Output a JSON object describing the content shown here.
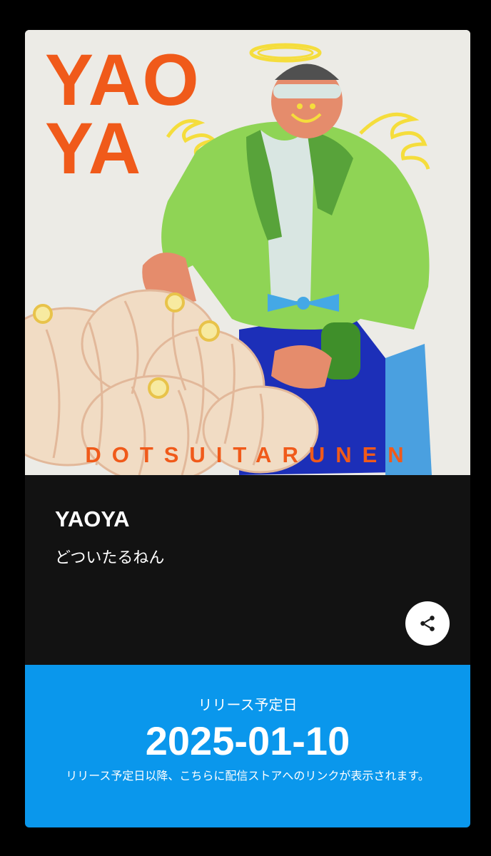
{
  "cover": {
    "title_text": "YAO\nYA",
    "artist_text": "DOTSUITARUNEN",
    "colors": {
      "background": "#ecebe6",
      "accent": "#f05a1a",
      "jacket": "#8fd455",
      "pants": "#1c2fb8",
      "onion": "#f1dcc4",
      "halo": "#f5dd3c"
    }
  },
  "album": {
    "title": "YAOYA",
    "artist": "どついたるねん"
  },
  "share": {
    "icon": "share-icon"
  },
  "release": {
    "label": "リリース予定日",
    "date": "2025-01-10",
    "note": "リリース予定日以降、こちらに配信ストアへのリンクが表示されます。",
    "color": "#0a97ec"
  }
}
